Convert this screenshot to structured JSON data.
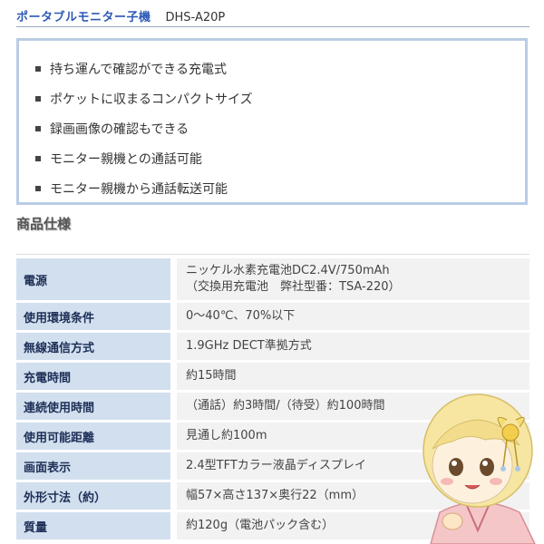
{
  "header": {
    "title": "ポータブルモニター子機",
    "model": "DHS-A20P"
  },
  "features": [
    "持ち運んで確認ができる充電式",
    "ポケットに収まるコンパクトサイズ",
    "録画画像の確認もできる",
    "モニター親機との通話可能",
    "モニター親機から通話転送可能"
  ],
  "section_title": "商品仕様",
  "specs": [
    {
      "key": "電源",
      "lines": [
        "ニッケル水素充電池DC2.4V/750mAh",
        "（交換用充電池　弊社型番：TSA-220）"
      ]
    },
    {
      "key": "使用環境条件",
      "lines": [
        "0～40℃、70%以下"
      ]
    },
    {
      "key": "無線通信方式",
      "lines": [
        "1.9GHz DECT準拠方式"
      ]
    },
    {
      "key": "充電時間",
      "lines": [
        "約15時間"
      ]
    },
    {
      "key": "連続使用時間",
      "lines": [
        "（通話）約3時間/（待受）約100時間"
      ]
    },
    {
      "key": "使用可能距離",
      "lines": [
        "見通し約100m"
      ]
    },
    {
      "key": "画面表示",
      "lines": [
        "2.4型TFTカラー液晶ディスプレイ"
      ]
    },
    {
      "key": "外形寸法（約）",
      "lines": [
        "幅57×高さ137×奥行22（mm）"
      ]
    },
    {
      "key": "質量",
      "lines": [
        "約120g（電池パック含む）"
      ]
    }
  ]
}
